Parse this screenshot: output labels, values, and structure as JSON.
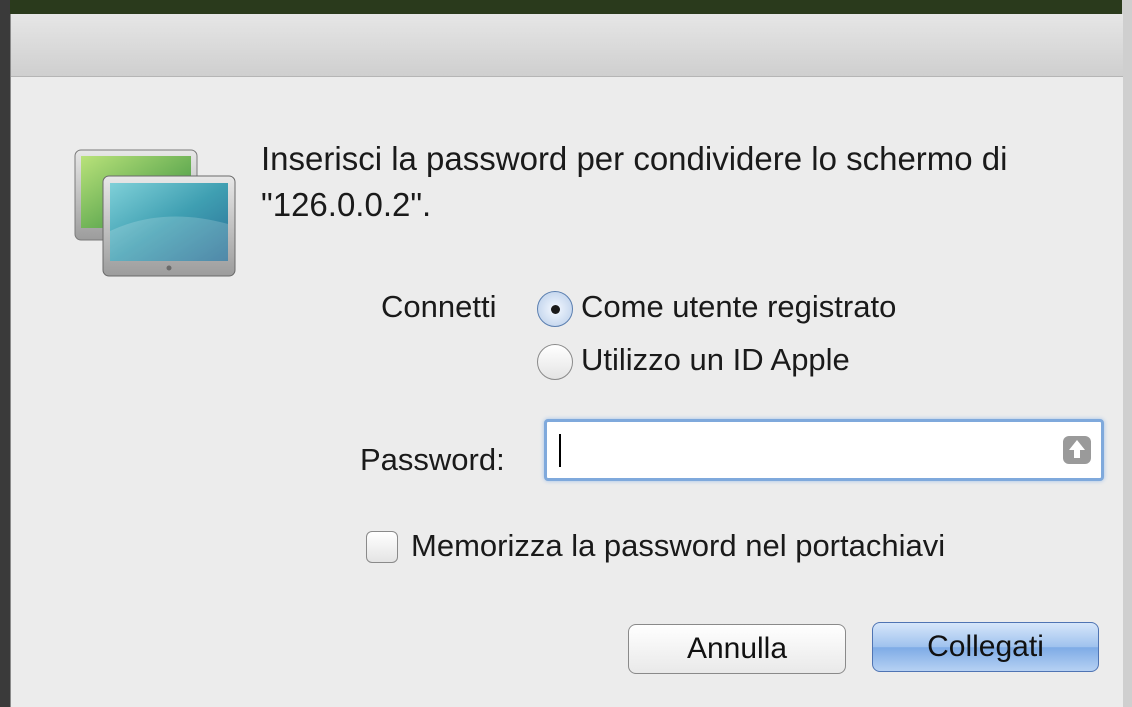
{
  "dialog": {
    "message": "Inserisci la password per condividere lo schermo di \"126.0.0.2\".",
    "app_icon": "screen-sharing-icon"
  },
  "connect": {
    "label": "Connetti",
    "options": [
      {
        "label": "Come utente registrato",
        "selected": true
      },
      {
        "label": "Utilizzo un ID Apple",
        "selected": false
      }
    ]
  },
  "password": {
    "label": "Password:",
    "value": "",
    "caps_lock_icon": "caps-lock-icon"
  },
  "keychain": {
    "label": "Memorizza la password nel portachiavi",
    "checked": false
  },
  "buttons": {
    "cancel": "Annulla",
    "connect": "Collegati"
  },
  "colors": {
    "default_button": "#8fb6ea",
    "focus_ring": "#7fa9dc"
  }
}
